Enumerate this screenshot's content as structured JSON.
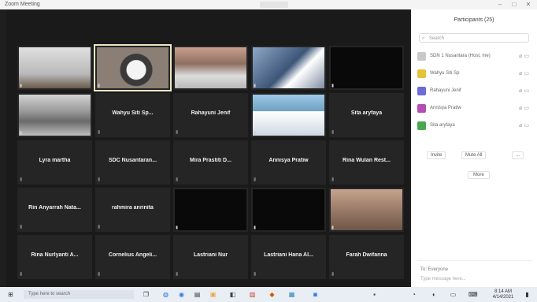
{
  "window": {
    "title": "Zoom Meeting",
    "controls": [
      "–",
      "□",
      "✕"
    ]
  },
  "tiles": [
    {
      "name": "",
      "video": "v-face1",
      "small": ""
    },
    {
      "name": "",
      "video": "v-face2",
      "small": "",
      "active": true
    },
    {
      "name": "",
      "video": "v-face3",
      "small": ""
    },
    {
      "name": "",
      "video": "v-face4",
      "small": ""
    },
    {
      "name": "",
      "video": "v-black",
      "small": ""
    },
    {
      "name": "",
      "video": "v-car",
      "small": ""
    },
    {
      "name": "Wahyu Siti Sp...",
      "video": "",
      "small": ""
    },
    {
      "name": "Rahayuni Jenif",
      "video": "",
      "small": ""
    },
    {
      "name": "",
      "video": "v-screen",
      "small": ""
    },
    {
      "name": "Sita aryfaya",
      "video": "",
      "small": ""
    },
    {
      "name": "Lyra martha",
      "video": "",
      "small": ""
    },
    {
      "name": "SDC Nusantaran...",
      "video": "",
      "small": ""
    },
    {
      "name": "Mira Prastiti D...",
      "video": "",
      "small": ""
    },
    {
      "name": "Annisya Pratiw",
      "video": "",
      "small": ""
    },
    {
      "name": "Rina Wulan Rest...",
      "video": "",
      "small": ""
    },
    {
      "name": "Rin Anyarrah Nata...",
      "video": "",
      "small": ""
    },
    {
      "name": "rahmira anrinita",
      "video": "",
      "small": ""
    },
    {
      "name": "",
      "video": "v-black",
      "small": ""
    },
    {
      "name": "",
      "video": "v-black",
      "small": ""
    },
    {
      "name": "",
      "video": "v-room",
      "small": ""
    },
    {
      "name": "Rina Nurlyanti A...",
      "video": "",
      "small": ""
    },
    {
      "name": "Cornelius Angeli...",
      "video": "",
      "small": ""
    },
    {
      "name": "Lastriani Nur",
      "video": "",
      "small": ""
    },
    {
      "name": "Lastriani Hana Al...",
      "video": "",
      "small": ""
    },
    {
      "name": "Farah Dwifanna",
      "video": "",
      "small": ""
    }
  ],
  "panel": {
    "title": "Participants (25)",
    "search_placeholder": "Search",
    "participants": [
      {
        "name": "SDN 1 Nusantara (Host, me)",
        "color": "#c9c9c9"
      },
      {
        "name": "Wahyu Siti Sp",
        "color": "#e6c23a"
      },
      {
        "name": "Rahayuni Jenif",
        "color": "#6e6ad8"
      },
      {
        "name": "Annisya Pratiw",
        "color": "#b24fb5"
      },
      {
        "name": "Sita aryfaya",
        "color": "#49a84f"
      }
    ],
    "buttons": [
      "Invite",
      "Mute All",
      "..."
    ],
    "more_label": "More",
    "chat_to": "To: Everyone",
    "chat_placeholder": "Type message here..."
  },
  "taskbar": {
    "search_placeholder": "Type here to search",
    "clock_time": "8:14 AM",
    "clock_date": "4/14/2021"
  }
}
